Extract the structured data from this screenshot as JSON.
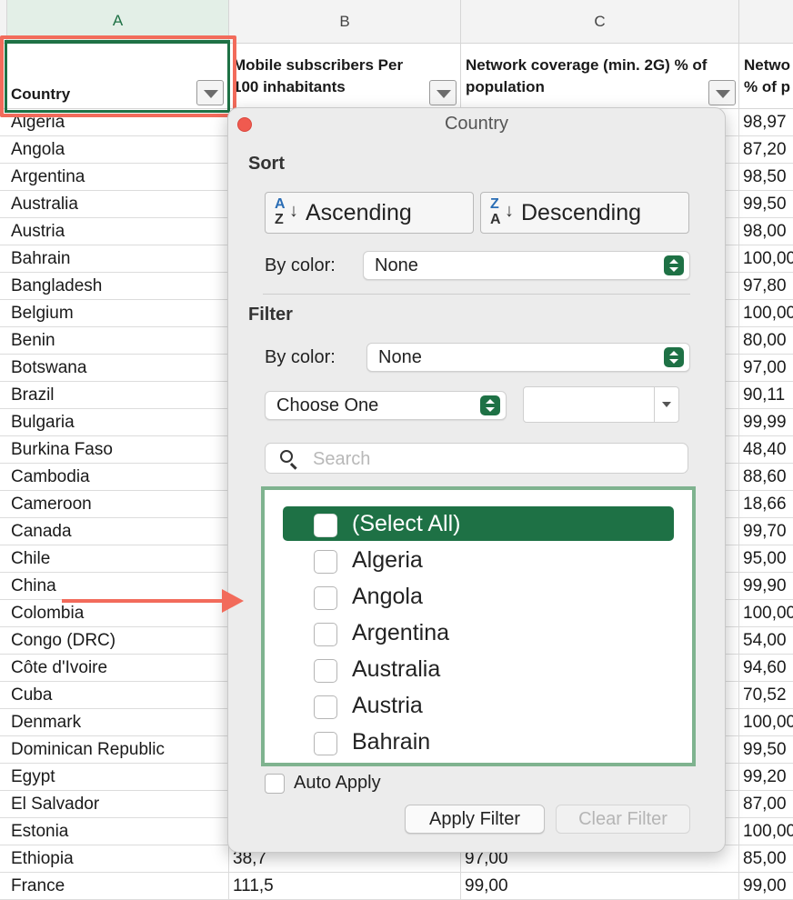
{
  "columns": [
    "A",
    "B",
    "C"
  ],
  "headers": {
    "a": "Country",
    "b": "Mobile subscribers Per 100 inhabitants",
    "c": "Network coverage (min. 2G) % of population",
    "d": "Netwo % of p"
  },
  "rows": [
    {
      "country": "Algeria",
      "b": "",
      "c": "",
      "d": "98,97"
    },
    {
      "country": "Angola",
      "b": "",
      "c": "",
      "d": "87,20"
    },
    {
      "country": "Argentina",
      "b": "",
      "c": "",
      "d": "98,50"
    },
    {
      "country": "Australia",
      "b": "",
      "c": "",
      "d": "99,50"
    },
    {
      "country": "Austria",
      "b": "",
      "c": "",
      "d": "98,00"
    },
    {
      "country": "Bahrain",
      "b": "",
      "c": "",
      "d": "100,00"
    },
    {
      "country": "Bangladesh",
      "b": "",
      "c": "",
      "d": "97,80"
    },
    {
      "country": "Belgium",
      "b": "",
      "c": "",
      "d": "100,00"
    },
    {
      "country": "Benin",
      "b": "",
      "c": "",
      "d": "80,00"
    },
    {
      "country": "Botswana",
      "b": "",
      "c": "",
      "d": "97,00"
    },
    {
      "country": "Brazil",
      "b": "",
      "c": "",
      "d": "90,11"
    },
    {
      "country": "Bulgaria",
      "b": "",
      "c": "",
      "d": "99,99"
    },
    {
      "country": "Burkina Faso",
      "b": "",
      "c": "",
      "d": "48,40"
    },
    {
      "country": "Cambodia",
      "b": "",
      "c": "",
      "d": "88,60"
    },
    {
      "country": "Cameroon",
      "b": "",
      "c": "",
      "d": "18,66"
    },
    {
      "country": "Canada",
      "b": "",
      "c": "",
      "d": "99,70"
    },
    {
      "country": "Chile",
      "b": "",
      "c": "",
      "d": "95,00"
    },
    {
      "country": "China",
      "b": "",
      "c": "",
      "d": "99,90"
    },
    {
      "country": "Colombia",
      "b": "",
      "c": "",
      "d": "100,00"
    },
    {
      "country": "Congo (DRC)",
      "b": "",
      "c": "",
      "d": "54,00"
    },
    {
      "country": "Côte d'Ivoire",
      "b": "",
      "c": "",
      "d": "94,60"
    },
    {
      "country": "Cuba",
      "b": "",
      "c": "",
      "d": "70,52"
    },
    {
      "country": "Denmark",
      "b": "",
      "c": "",
      "d": "100,00"
    },
    {
      "country": "Dominican Republic",
      "b": "",
      "c": "",
      "d": "99,50"
    },
    {
      "country": "Egypt",
      "b": "",
      "c": "",
      "d": "99,20"
    },
    {
      "country": "El Salvador",
      "b": "",
      "c": "",
      "d": "87,00"
    },
    {
      "country": "Estonia",
      "b": "",
      "c": "",
      "d": "100,00"
    },
    {
      "country": "Ethiopia",
      "b": "38,7",
      "c": "97,00",
      "d": "85,00"
    },
    {
      "country": "France",
      "b": "111,5",
      "c": "99,00",
      "d": "99,00"
    }
  ],
  "popover": {
    "title": "Country",
    "sort_heading": "Sort",
    "ascending": "Ascending",
    "descending": "Descending",
    "asc_icon": {
      "l1": "A",
      "l2": "Z",
      "arrow": "↓"
    },
    "desc_icon": {
      "l1": "Z",
      "l2": "A",
      "arrow": "↓"
    },
    "by_color_label": "By color:",
    "sort_by_color": "None",
    "filter_heading": "Filter",
    "filter_by_color": "None",
    "condition": "Choose One",
    "condition_value": "",
    "search_placeholder": "Search",
    "list": [
      "(Select All)",
      "Algeria",
      "Angola",
      "Argentina",
      "Australia",
      "Austria",
      "Bahrain"
    ],
    "auto_apply": "Auto Apply",
    "apply_filter": "Apply Filter",
    "clear_filter": "Clear Filter"
  },
  "colors": {
    "accent": "#1e7145",
    "annotation": "#f26b5b",
    "list_border": "#7fb38f"
  }
}
